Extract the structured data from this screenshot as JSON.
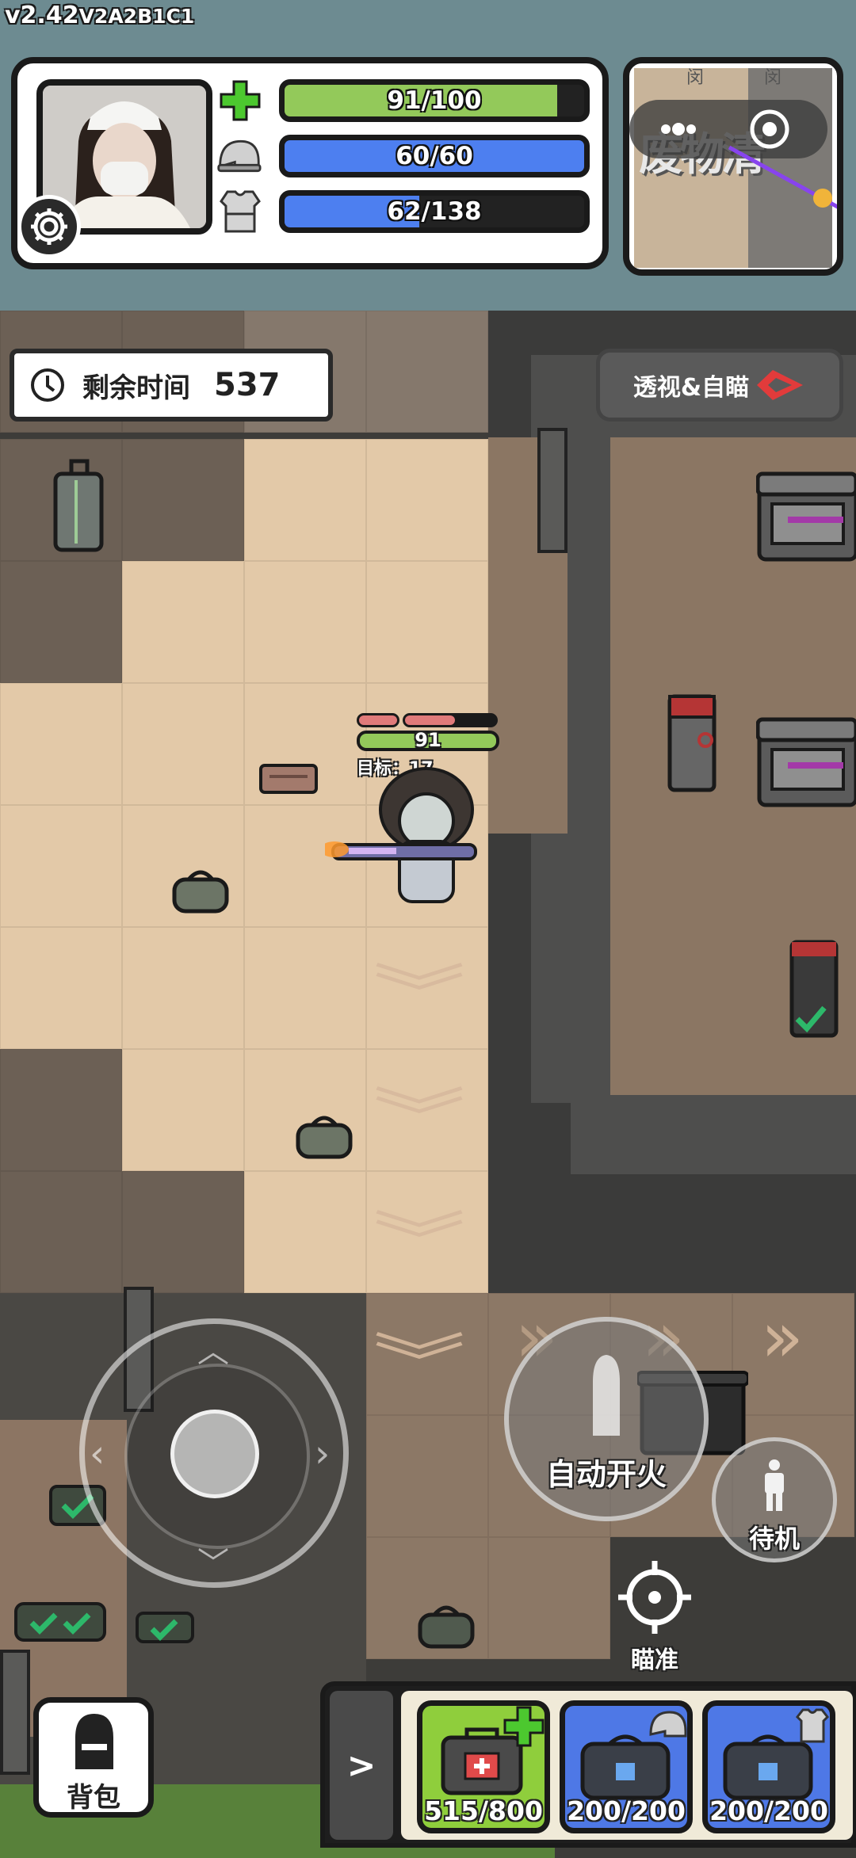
{
  "version": "v2.42",
  "build": "V2A2B1C1",
  "status": {
    "health": {
      "text": "91/100",
      "value": 91,
      "max": 100,
      "color": "#93c95a"
    },
    "helmet": {
      "text": "60/60",
      "value": 60,
      "max": 60,
      "color": "#4d7ff0"
    },
    "armor": {
      "text": "62/138",
      "value": 62,
      "max": 138,
      "color": "#4d7ff0"
    }
  },
  "minimap": {
    "area_label": "废物清",
    "tags": [
      "闵",
      "闵"
    ]
  },
  "timer": {
    "label": "剩余时间",
    "value": "537"
  },
  "xray_button": {
    "label": "透视&自瞄"
  },
  "player": {
    "hp_label": "91",
    "target_label": "目标：17"
  },
  "controls": {
    "fire_label": "自动开火",
    "standby_label": "待机",
    "aim_label": "瞄准",
    "backpack_label": "背包",
    "expand_icon": ">"
  },
  "quickbar": {
    "slots": [
      {
        "count": "515/800",
        "kind": "medkit",
        "bg": "#8fce3c"
      },
      {
        "count": "200/200",
        "kind": "helmet-bag",
        "bg": "#4e78e6"
      },
      {
        "count": "200/200",
        "kind": "armor-bag",
        "bg": "#4e78e6"
      }
    ]
  },
  "colors": {
    "accent_red": "#e04a4a",
    "hud_bg": "#6d8b91",
    "tile_light": "#e3c9a8",
    "tile_dark": "#6c6055"
  }
}
